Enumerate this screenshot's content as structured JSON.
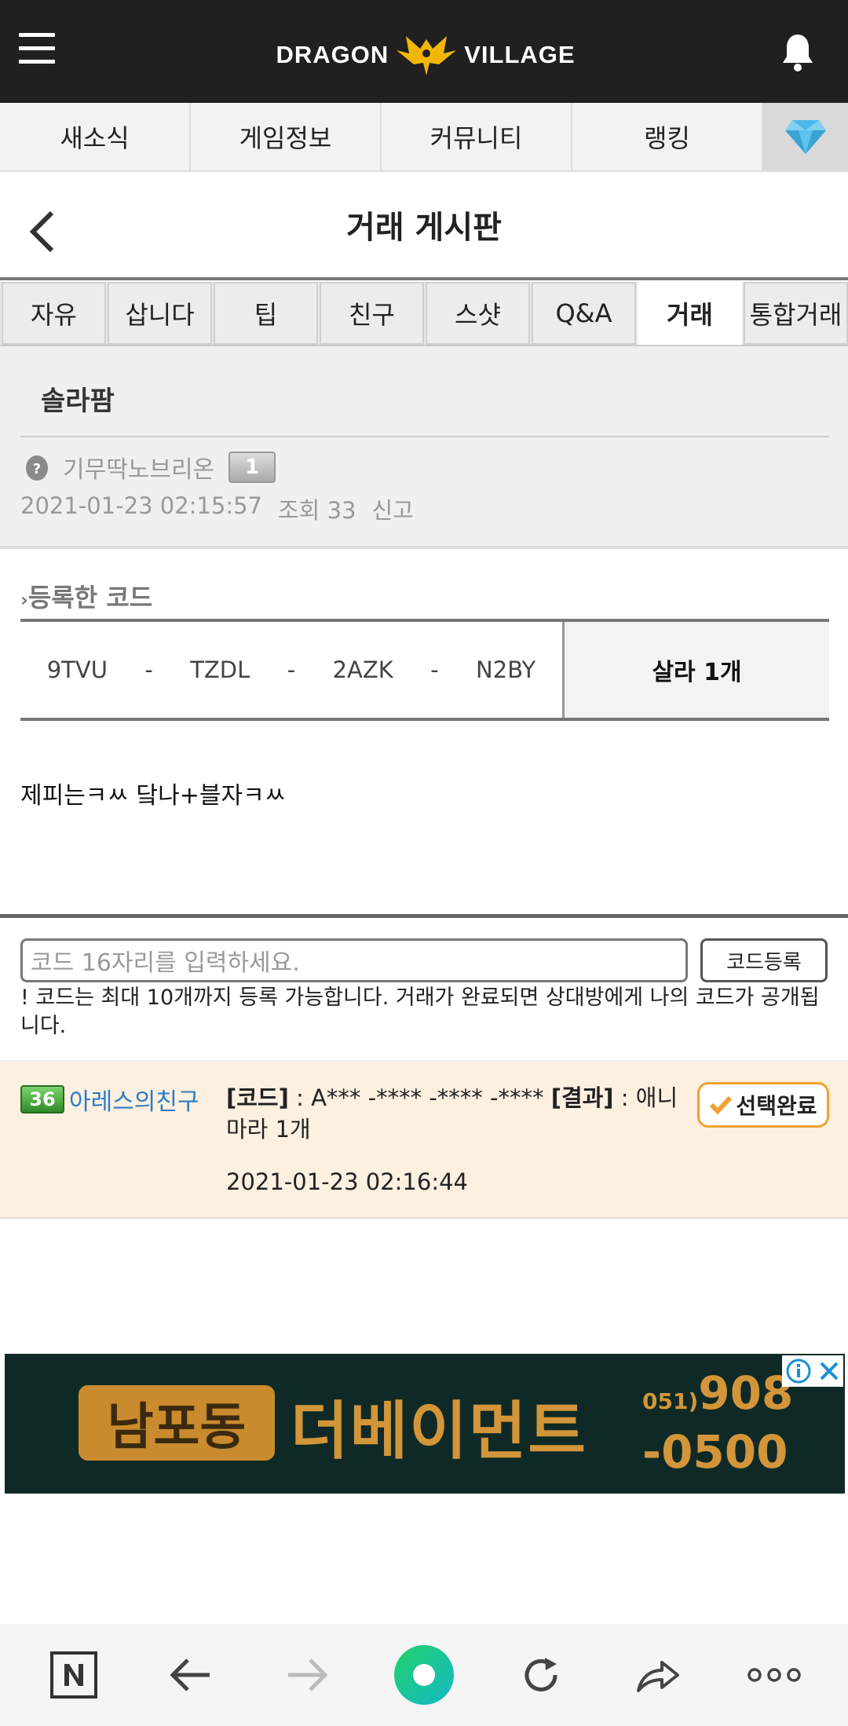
{
  "app": {
    "logo_left": "DRAGON",
    "logo_right": "VILLAGE"
  },
  "nav": {
    "items": [
      "새소식",
      "게임정보",
      "커뮤니티",
      "랭킹"
    ]
  },
  "page": {
    "title": "거래 게시판"
  },
  "tabs": [
    "자유",
    "삽니다",
    "팁",
    "친구",
    "스샷",
    "Q&A",
    "거래",
    "통합거래"
  ],
  "active_tab": "거래",
  "post": {
    "title": "솔라팜",
    "author": "기무딱노브리온",
    "level": "1",
    "date": "2021-01-23 02:15:57",
    "views": "조회 33",
    "report": "신고"
  },
  "code_section": {
    "title": "등록한 코드",
    "code_parts": [
      "9TVU",
      "TZDL",
      "2AZK",
      "N2BY"
    ],
    "separator": "-",
    "status": "살라 1개"
  },
  "content": "제피는ㅋㅆ 닼나+블자ㅋㅆ",
  "input": {
    "placeholder": "코드 16자리를 입력하세요.",
    "button": "코드등록",
    "notice": "! 코드는 최대 10개까지 등록 가능합니다. 거래가 완료되면 상대방에게 나의 코드가 공개됩니다."
  },
  "offer": {
    "level": "36",
    "user": "아레스의친구",
    "code_label": "[코드]",
    "code_value": " : A*** -**** -**** -**** ",
    "result_label": "[결과]",
    "result_value": " : 애니마라 1개",
    "date": "2021-01-23 02:16:44",
    "button": "선택완료"
  },
  "ad": {
    "badge": "남포동",
    "name": "더베이먼트",
    "area_code": "051)",
    "phone_line1": "908",
    "phone_line2": "-0500"
  },
  "colors": {
    "topbar": "#202020",
    "link": "#2a7bc4",
    "offer_bg": "#fdf0e1",
    "accent_orange": "#f0a030",
    "gem": "#4db8e8"
  },
  "icons": [
    "menu-icon",
    "dragon-logo-icon",
    "bell-icon",
    "diamond-icon",
    "back-chevron-icon",
    "egg-icon",
    "check-icon",
    "info-icon",
    "close-icon",
    "n-home-icon",
    "arrow-left-icon",
    "arrow-right-icon",
    "green-circle-icon",
    "refresh-icon",
    "share-icon",
    "more-icon"
  ]
}
